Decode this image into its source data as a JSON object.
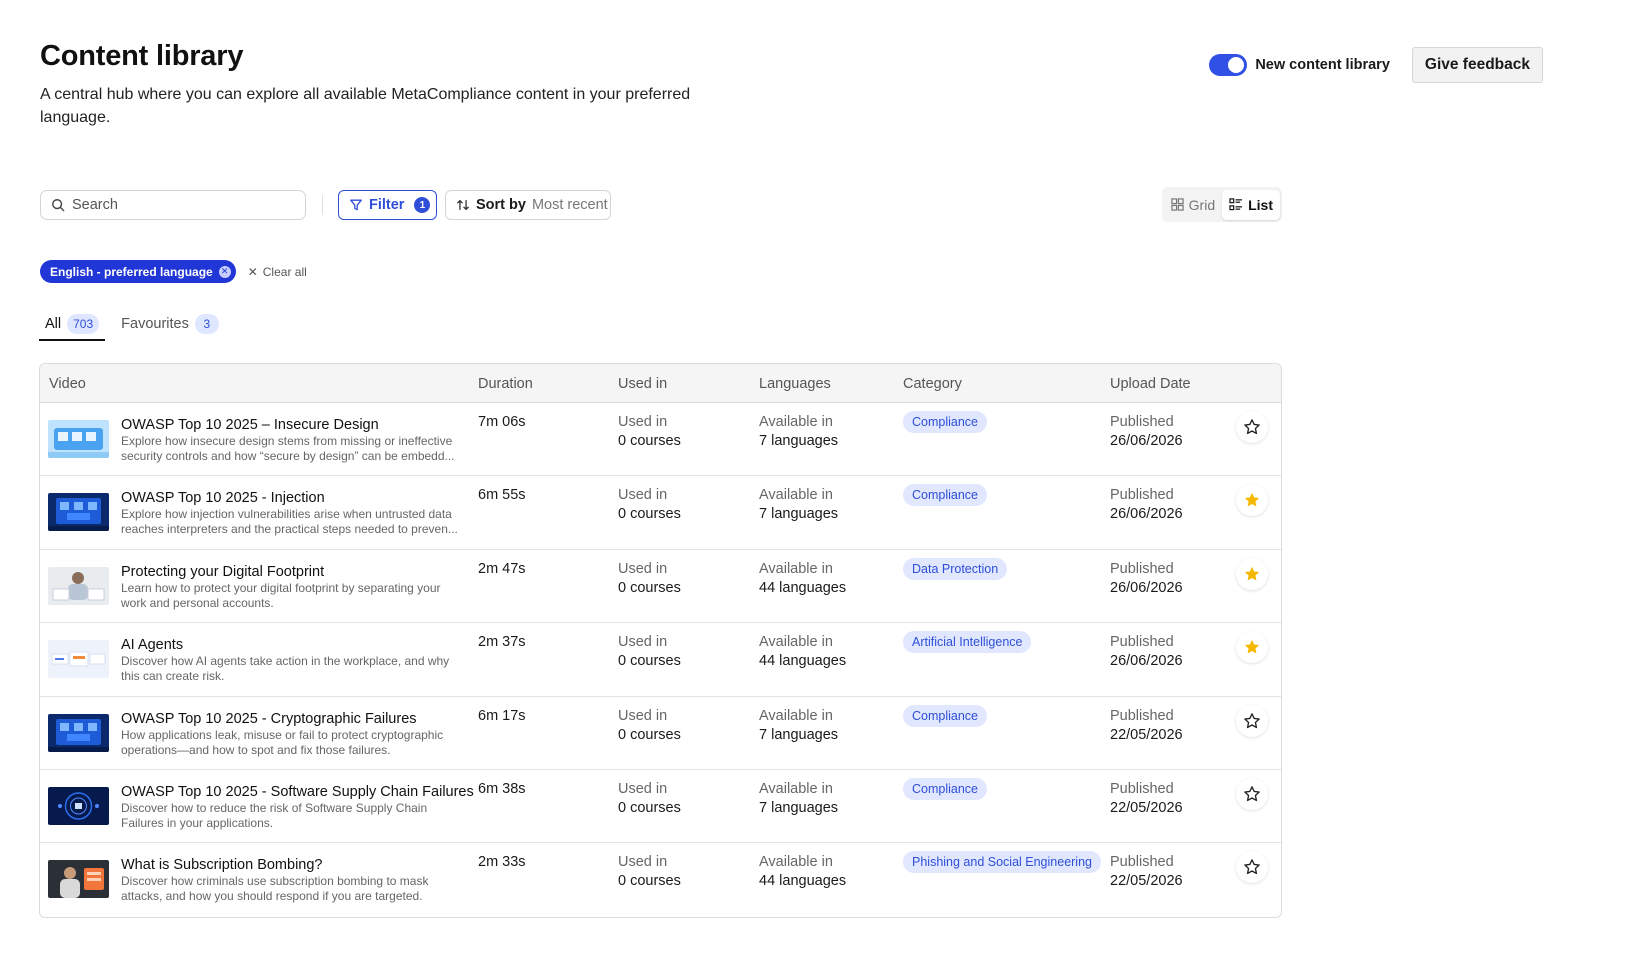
{
  "header": {
    "title": "Content library",
    "description": "A central hub where you can explore all available MetaCompliance content in your preferred language."
  },
  "top_actions": {
    "toggle_label": "New content library",
    "toggle_on": true,
    "feedback_label": "Give feedback"
  },
  "toolbar": {
    "search_placeholder": "Search",
    "filter_label": "Filter",
    "filter_count": "1",
    "sort_label": "Sort by",
    "sort_value": "Most recent",
    "view_grid": "Grid",
    "view_list": "List",
    "active_view": "list"
  },
  "filters": {
    "chip_label": "English - preferred language",
    "clear_label": "Clear all"
  },
  "tabs": [
    {
      "label": "All",
      "count": "703"
    },
    {
      "label": "Favourites",
      "count": "3"
    }
  ],
  "table": {
    "columns": [
      "Video",
      "Duration",
      "Used in",
      "Languages",
      "Category",
      "Upload Date"
    ],
    "rows": [
      {
        "title": "OWASP Top 10 2025 – Insecure Design",
        "desc": "Explore how insecure design stems from missing or ineffective security controls and how “secure by design” can be embedd...",
        "duration": "7m 06s",
        "used_label": "Used in",
        "used_value": "0 courses",
        "lang_label": "Available in",
        "lang_value": "7 languages",
        "category": "Compliance",
        "pub_label": "Published",
        "pub_date": "26/06/2026",
        "favourite": false,
        "thumb": "blue-light"
      },
      {
        "title": "OWASP Top 10 2025 - Injection",
        "desc": "Explore how injection vulnerabilities arise when untrusted data reaches interpreters and the practical steps needed to preven...",
        "duration": "6m 55s",
        "used_label": "Used in",
        "used_value": "0 courses",
        "lang_label": "Available in",
        "lang_value": "7 languages",
        "category": "Compliance",
        "pub_label": "Published",
        "pub_date": "26/06/2026",
        "favourite": true,
        "thumb": "blue-dark"
      },
      {
        "title": "Protecting your Digital Footprint",
        "desc": "Learn how to protect your digital footprint by separating your work and personal accounts.",
        "duration": "2m 47s",
        "used_label": "Used in",
        "used_value": "0 courses",
        "lang_label": "Available in",
        "lang_value": "44 languages",
        "category": "Data Protection",
        "pub_label": "Published",
        "pub_date": "26/06/2026",
        "favourite": true,
        "thumb": "person-light"
      },
      {
        "title": "AI Agents",
        "desc": "Discover how AI agents take action in the workplace, and why this can create risk.",
        "duration": "2m 37s",
        "used_label": "Used in",
        "used_value": "0 courses",
        "lang_label": "Available in",
        "lang_value": "44 languages",
        "category": "Artificial Intelligence",
        "pub_label": "Published",
        "pub_date": "26/06/2026",
        "favourite": true,
        "thumb": "ui-light"
      },
      {
        "title": "OWASP Top 10 2025 - Cryptographic Failures",
        "desc": "How applications leak, misuse or fail to protect cryptographic operations—and how to spot and fix those failures.",
        "duration": "6m 17s",
        "used_label": "Used in",
        "used_value": "0 courses",
        "lang_label": "Available in",
        "lang_value": "7 languages",
        "category": "Compliance",
        "pub_label": "Published",
        "pub_date": "22/05/2026",
        "favourite": false,
        "thumb": "blue-dark"
      },
      {
        "title": "OWASP Top 10 2025 - Software Supply Chain Failures",
        "desc": "Discover how to reduce the risk of Software Supply Chain Failures in your applications.",
        "duration": "6m 38s",
        "used_label": "Used in",
        "used_value": "0 courses",
        "lang_label": "Available in",
        "lang_value": "7 languages",
        "category": "Compliance",
        "pub_label": "Published",
        "pub_date": "22/05/2026",
        "favourite": false,
        "thumb": "navy-circle"
      },
      {
        "title": "What is Subscription Bombing?",
        "desc": "Discover how criminals use subscription bombing to mask attacks, and how you should respond if you are targeted.",
        "duration": "2m 33s",
        "used_label": "Used in",
        "used_value": "0 courses",
        "lang_label": "Available in",
        "lang_value": "44 languages",
        "category": "Phishing and Social Engineering",
        "pub_label": "Published",
        "pub_date": "22/05/2026",
        "favourite": false,
        "thumb": "person-dark"
      }
    ]
  },
  "colors": {
    "accent": "#2f4fd8",
    "chip": "#2136d6",
    "star": "#f5b800"
  }
}
